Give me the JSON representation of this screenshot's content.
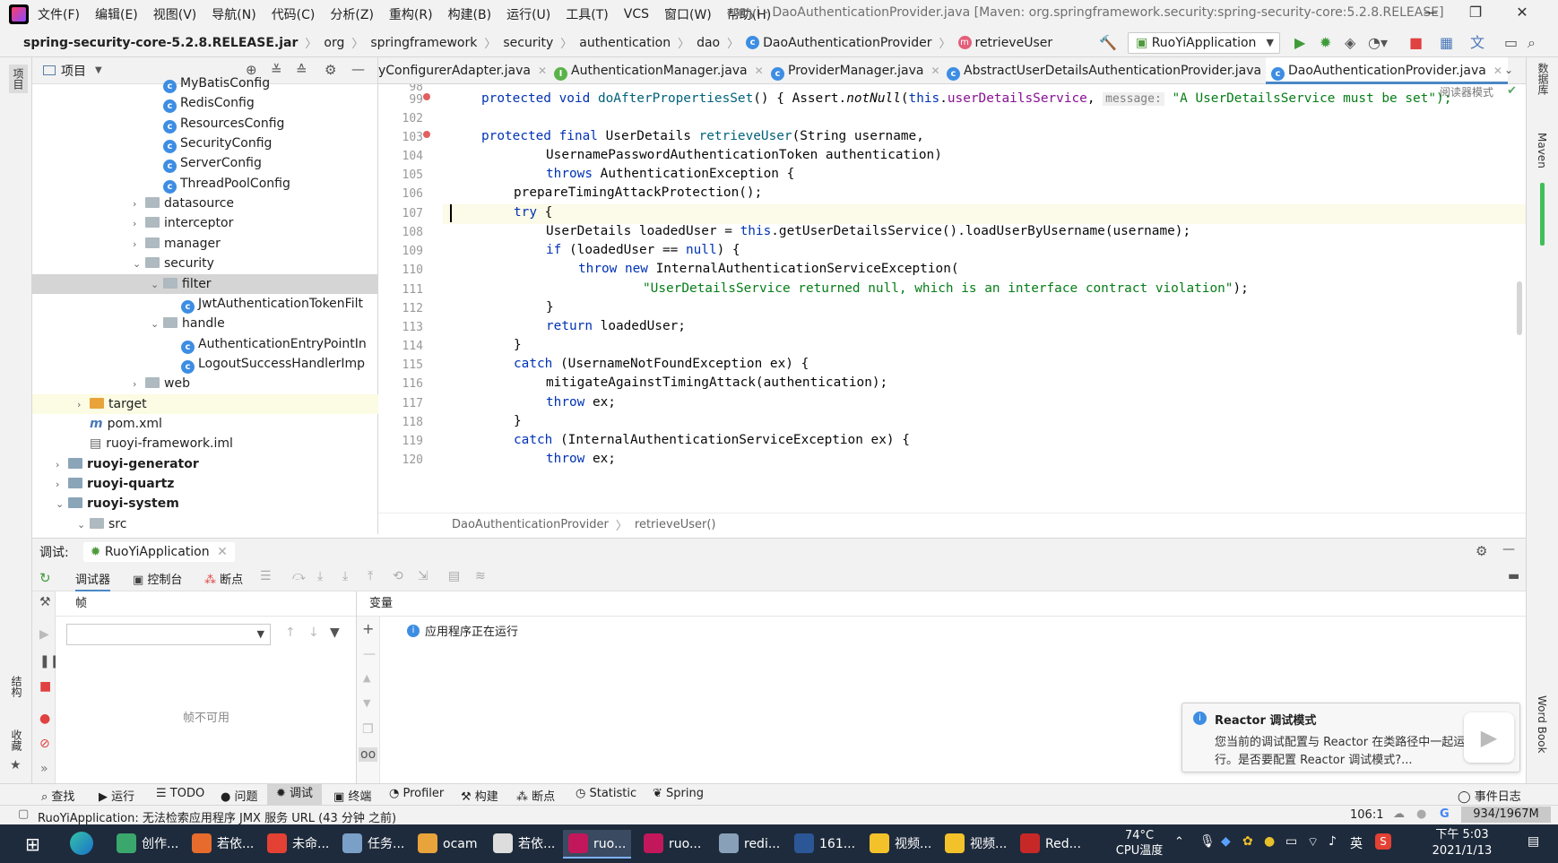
{
  "menu": [
    "文件(F)",
    "编辑(E)",
    "视图(V)",
    "导航(N)",
    "代码(C)",
    "分析(Z)",
    "重构(R)",
    "构建(B)",
    "运行(U)",
    "工具(T)",
    "VCS",
    "窗口(W)",
    "帮助(H)"
  ],
  "window_title": "ruoyi - DaoAuthenticationProvider.java [Maven: org.springframework.security:spring-security-core:5.2.8.RELEASE]",
  "breadcrumbs": [
    "spring-security-core-5.2.8.RELEASE.jar",
    "org",
    "springframework",
    "security",
    "authentication",
    "dao",
    "DaoAuthenticationProvider",
    "retrieveUser"
  ],
  "run_config": "RuoYiApplication",
  "project_panel": {
    "title": "项目",
    "items": [
      {
        "label": "MyBatisConfig",
        "type": "class",
        "indent": 4
      },
      {
        "label": "RedisConfig",
        "type": "class",
        "indent": 4
      },
      {
        "label": "ResourcesConfig",
        "type": "class",
        "indent": 4
      },
      {
        "label": "SecurityConfig",
        "type": "class",
        "indent": 4
      },
      {
        "label": "ServerConfig",
        "type": "class",
        "indent": 4
      },
      {
        "label": "ThreadPoolConfig",
        "type": "class",
        "indent": 4
      },
      {
        "label": "datasource",
        "type": "folder",
        "indent": 3,
        "arrow": "›"
      },
      {
        "label": "interceptor",
        "type": "folder",
        "indent": 3,
        "arrow": "›"
      },
      {
        "label": "manager",
        "type": "folder",
        "indent": 3,
        "arrow": "›"
      },
      {
        "label": "security",
        "type": "folder",
        "indent": 3,
        "arrow": "⌄"
      },
      {
        "label": "filter",
        "type": "folder",
        "indent": 4,
        "arrow": "⌄",
        "selected": true
      },
      {
        "label": "JwtAuthenticationTokenFilt",
        "type": "class",
        "indent": 5
      },
      {
        "label": "handle",
        "type": "folder",
        "indent": 4,
        "arrow": "⌄"
      },
      {
        "label": "AuthenticationEntryPointIn",
        "type": "class",
        "indent": 5
      },
      {
        "label": "LogoutSuccessHandlerImp",
        "type": "class",
        "indent": 5
      },
      {
        "label": "web",
        "type": "folder",
        "indent": 3,
        "arrow": "›"
      },
      {
        "label": "target",
        "type": "folder-orange",
        "indent": 1,
        "arrow": "›",
        "highlight": true
      },
      {
        "label": "pom.xml",
        "type": "maven",
        "indent": 1
      },
      {
        "label": "ruoyi-framework.iml",
        "type": "file",
        "indent": 1
      },
      {
        "label": "ruoyi-generator",
        "type": "module",
        "indent": 0,
        "arrow": "›"
      },
      {
        "label": "ruoyi-quartz",
        "type": "module",
        "indent": 0,
        "arrow": "›"
      },
      {
        "label": "ruoyi-system",
        "type": "module",
        "indent": 0,
        "arrow": "⌄"
      },
      {
        "label": "src",
        "type": "folder",
        "indent": 1,
        "arrow": "⌄"
      }
    ]
  },
  "tabs": [
    {
      "label": "yConfigurerAdapter.java",
      "icon": "c"
    },
    {
      "label": "AuthenticationManager.java",
      "icon": "i"
    },
    {
      "label": "ProviderManager.java",
      "icon": "c"
    },
    {
      "label": "AbstractUserDetailsAuthenticationProvider.java",
      "icon": "c"
    },
    {
      "label": "DaoAuthenticationProvider.java",
      "icon": "c",
      "active": true
    }
  ],
  "reader_mode": "阅读器模式",
  "code": {
    "line_numbers": [
      "98",
      "99",
      "102",
      "103",
      "104",
      "105",
      "106",
      "107",
      "108",
      "109",
      "110",
      "111",
      "112",
      "113",
      "114",
      "115",
      "116",
      "117",
      "118",
      "119",
      "120"
    ],
    "hint_message": "message:",
    "hint_string": "\"A UserDetailsService must be set\");",
    "l99a": "protected void ",
    "l99b": "doAfterPropertiesSet",
    "l99c": "() { Assert.",
    "l99d": "notNull",
    "l99e": "(",
    "l99f": "this",
    "l99g": ".",
    "l99h": "userDetailsService",
    "l99i": ",",
    "l103a": "protected final ",
    "l103b": "UserDetails ",
    "l103c": "retrieveUser",
    "l103d": "(String username,",
    "l104": "UsernamePasswordAuthenticationToken authentication)",
    "l105a": "throws ",
    "l105b": "AuthenticationException {",
    "l106": "prepareTimingAttackProtection();",
    "l107a": "try",
    "l107b": " {",
    "l108a": "UserDetails loadedUser = ",
    "l108b": "this",
    "l108c": ".getUserDetailsService().loadUserByUsername(username);",
    "l109a": "if",
    "l109b": " (loadedUser == ",
    "l109c": "null",
    "l109d": ") {",
    "l110a": "throw new ",
    "l110b": "InternalAuthenticationServiceException(",
    "l111": "\"UserDetailsService returned null, which is an interface contract violation\"",
    "l111b": ");",
    "l112": "}",
    "l113a": "return ",
    "l113b": "loadedUser;",
    "l114": "}",
    "l115a": "catch",
    "l115b": " (UsernameNotFoundException ex) {",
    "l116": "mitigateAgainstTimingAttack(authentication);",
    "l117a": "throw ",
    "l117b": "ex;",
    "l118": "}",
    "l119a": "catch",
    "l119b": " (InternalAuthenticationServiceException ex) {",
    "l120a": "throw ",
    "l120b": "ex;"
  },
  "editor_breadcrumb": [
    "DaoAuthenticationProvider",
    "retrieveUser()"
  ],
  "debug": {
    "label": "调试:",
    "session": "RuoYiApplication",
    "tabs": [
      "调试器",
      "控制台",
      "断点"
    ],
    "frames_title": "帧",
    "frames_empty": "帧不可用",
    "vars_title": "变量",
    "running_msg": "应用程序正在运行"
  },
  "notification": {
    "title": "Reactor 调试模式",
    "body_line1": "您当前的调试配置与 Reactor 在类路径中一起运",
    "body_line2": "行。是否要配置 Reactor 调试模式?..."
  },
  "toolwindows": [
    "查找",
    "运行",
    "TODO",
    "问题",
    "调试",
    "终端",
    "Profiler",
    "构建",
    "断点",
    "Statistic",
    "Spring"
  ],
  "event_log": "事件日志",
  "status": {
    "message": "RuoYiApplication: 无法检索应用程序 JMX 服务 URL (43 分钟 之前)",
    "position": "106:1",
    "memory": "934/1967M"
  },
  "left_strip": [
    "项目",
    "结构",
    "收藏"
  ],
  "right_strip": [
    "数据库",
    "Maven",
    "Word Book"
  ],
  "taskbar": {
    "items": [
      {
        "label": "创作...",
        "color": "#3aa76d"
      },
      {
        "label": "若依...",
        "color": "#e66b2c"
      },
      {
        "label": "未命...",
        "color": "#e34133"
      },
      {
        "label": "任务...",
        "color": "#7aa0c8"
      },
      {
        "label": "ocam",
        "color": "#e8a33b"
      },
      {
        "label": "若依...",
        "color": "#dddddd"
      },
      {
        "label": "ruo...",
        "color": "#c2185b",
        "selected": true
      },
      {
        "label": "ruo...",
        "color": "#c2185b"
      },
      {
        "label": "redi...",
        "color": "#88a0b8"
      },
      {
        "label": "161...",
        "color": "#2b5797"
      },
      {
        "label": "视频...",
        "color": "#f3c12a"
      },
      {
        "label": "视频...",
        "color": "#f3c12a"
      },
      {
        "label": "Red...",
        "color": "#c62828"
      }
    ],
    "temp": "74°C",
    "temp_label": "CPU温度",
    "ime": "英",
    "time": "下午 5:03",
    "date": "2021/1/13"
  }
}
